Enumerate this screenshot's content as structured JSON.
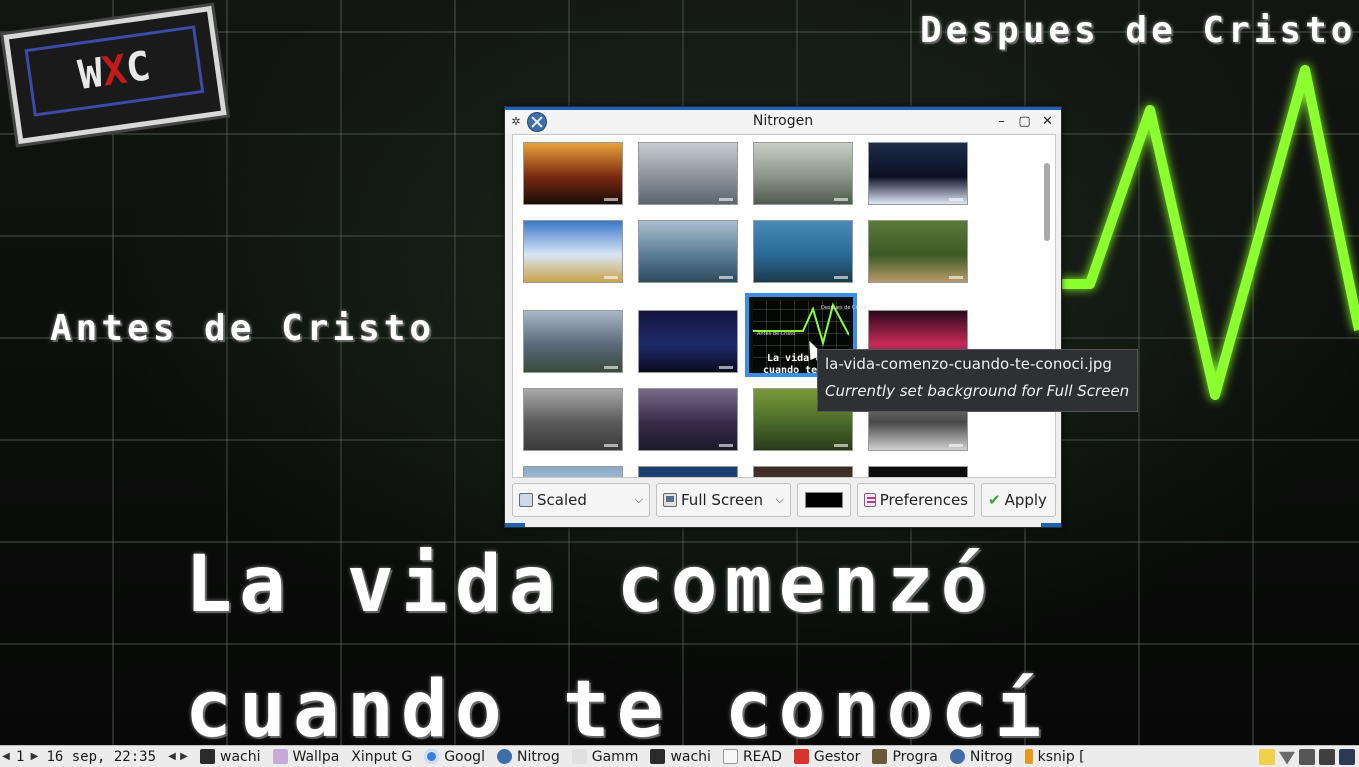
{
  "wallpaper": {
    "top_right_text": "Despues de Cristo",
    "left_text": "Antes de Cristo",
    "headline_line1": "La vida comenzó",
    "headline_line2": "cuando te conocí",
    "logo_text": "WXC",
    "pulse_color": "#8cff2e"
  },
  "window": {
    "title": "Nitrogen",
    "menu_icon": "gear-icon",
    "app_icon": "nitrogen-icon",
    "controls": {
      "minimize": "–",
      "maximize": "▢",
      "close": "✕"
    },
    "accent_color": "#1c63b8",
    "thumbnails": [
      {
        "name": "mountain-sunset",
        "colors": [
          "#e8a23a",
          "#7a2a10",
          "#1a0c08"
        ]
      },
      {
        "name": "gray-circles",
        "colors": [
          "#c8ccd0",
          "#8a939c",
          "#5a6570"
        ]
      },
      {
        "name": "white-grass",
        "colors": [
          "#c9cec5",
          "#8a958a",
          "#4f5b4f"
        ]
      },
      {
        "name": "moon-night",
        "colors": [
          "#1d2c4a",
          "#0a1022",
          "#e0e8f8"
        ]
      },
      {
        "name": "wheat-field",
        "colors": [
          "#3a78c8",
          "#d8e6f6",
          "#caa24a"
        ]
      },
      {
        "name": "blue-mountains",
        "colors": [
          "#a8c0d0",
          "#5a7d96",
          "#2e4a5e"
        ]
      },
      {
        "name": "waterfall",
        "colors": [
          "#4a8ab8",
          "#2a6a98",
          "#1a3a4a"
        ]
      },
      {
        "name": "duckling-flowers",
        "colors": [
          "#5a7a3a",
          "#3a5a24",
          "#b89a6a"
        ]
      },
      {
        "name": "lake-boats",
        "colors": [
          "#a8b8c8",
          "#5a6a7a",
          "#3a4a3a"
        ]
      },
      {
        "name": "jesus-inside",
        "colors": [
          "#141440",
          "#1e2a6a",
          "#0a0a20"
        ]
      },
      {
        "name": "la-vida-comenzo",
        "colors": [
          "#050705",
          "#8cff2e",
          "#ffffff"
        ]
      },
      {
        "name": "neon-street",
        "colors": [
          "#2a0a1a",
          "#c82a5a",
          "#1a0a24"
        ]
      },
      {
        "name": "gray-arrow",
        "colors": [
          "#a9a9a9",
          "#5a5a5a",
          "#3a3a3a"
        ]
      },
      {
        "name": "pier-dusk",
        "colors": [
          "#7a6a8a",
          "#3a2a4a",
          "#1a1a2a"
        ]
      },
      {
        "name": "green-river",
        "colors": [
          "#7a9a3a",
          "#4a6a2a",
          "#2a3a1a"
        ]
      },
      {
        "name": "gray-leaves",
        "colors": [
          "#8a8a8a",
          "#4a4a4a",
          "#d0d0d0"
        ]
      },
      {
        "name": "partial-1",
        "colors": [
          "#8aa8c8",
          "#c8d8e8",
          "#6a8aa8"
        ]
      },
      {
        "name": "partial-2",
        "colors": [
          "#1a3a6a",
          "#2a5a8a",
          "#0a2a4a"
        ]
      },
      {
        "name": "partial-3",
        "colors": [
          "#3a2a24",
          "#5a4a3a",
          "#2a1a14"
        ]
      },
      {
        "name": "partial-4",
        "colors": [
          "#0a0a0a",
          "#1a1a1a",
          "#000000"
        ]
      }
    ],
    "selected_thumbnail": {
      "small_top": "Despues de Cristo",
      "small_left": "Antes de Cristo",
      "line1": "La vida co",
      "line2": "cuando te c"
    },
    "scale_select": {
      "value": "Scaled",
      "icon": "image-icon"
    },
    "screen_select": {
      "value": "Full Screen",
      "icon": "monitor-icon"
    },
    "background_color": "#000000",
    "preferences_label": "Preferences",
    "apply_label": "Apply"
  },
  "tooltip": {
    "filename": "la-vida-comenzo-cuando-te-conoci.jpg",
    "status": "Currently set background for Full Screen"
  },
  "taskbar": {
    "workspace": "1",
    "clock": "16 sep, 22:35",
    "items": [
      {
        "label": "wachi",
        "icon": "terminal-icon"
      },
      {
        "label": "Wallpa",
        "icon": "folder-icon"
      },
      {
        "label": "Xinput G",
        "icon": ""
      },
      {
        "label": "Googl",
        "icon": "chrome-icon"
      },
      {
        "label": "Nitrog",
        "icon": "nitrogen-icon"
      },
      {
        "label": "Gamm",
        "icon": "gamma-icon"
      },
      {
        "label": "wachi",
        "icon": "terminal-icon"
      },
      {
        "label": "READ",
        "icon": "typora-icon"
      },
      {
        "label": "Gestor",
        "icon": "download-icon"
      },
      {
        "label": "Progra",
        "icon": "wine-icon"
      },
      {
        "label": "Nitrog",
        "icon": "nitrogen-icon"
      },
      {
        "label": "ksnip [",
        "icon": "ksnip-icon"
      }
    ]
  }
}
